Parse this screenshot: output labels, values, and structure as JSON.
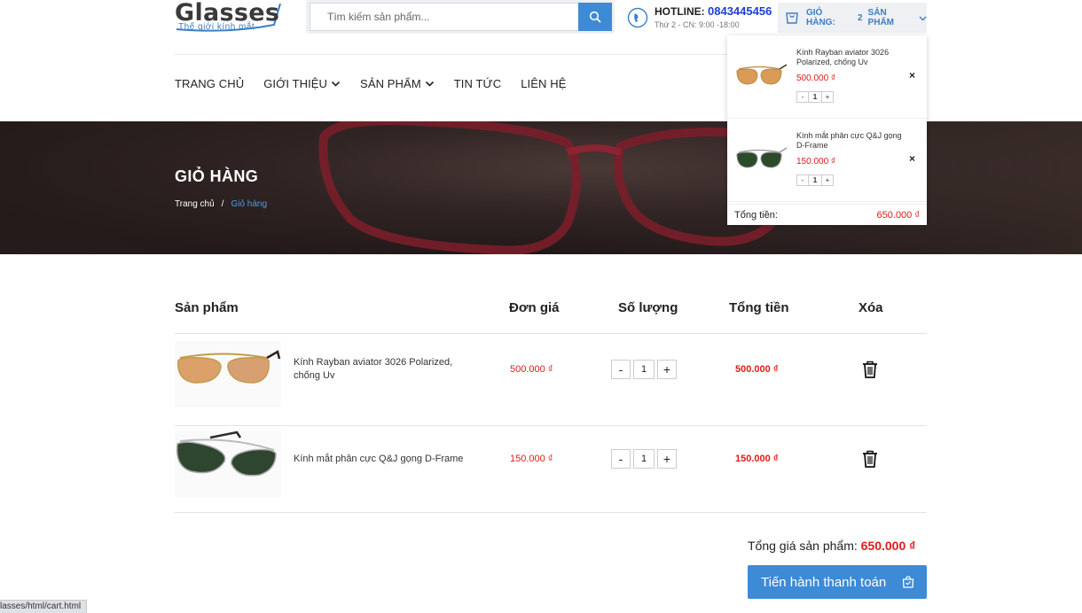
{
  "header": {
    "logo_text": "Glasses",
    "logo_tagline": "Thế giới kính mắt",
    "search_placeholder": "Tìm kiếm sản phẩm...",
    "hotline_label": "HOTLINE:",
    "hotline_number": "0843445456",
    "hotline_hours": "Thứ 2 - CN: 9:00 -18:00",
    "cart_label": "GIỎ HÀNG:",
    "cart_count": "2",
    "cart_unit": "SẢN PHẨM"
  },
  "nav": {
    "items": [
      {
        "label": "TRANG CHỦ",
        "has_dropdown": false
      },
      {
        "label": "GIỚI THIỆU",
        "has_dropdown": true
      },
      {
        "label": "SẢN PHẨM",
        "has_dropdown": true
      },
      {
        "label": "TIN TỨC",
        "has_dropdown": false
      },
      {
        "label": "LIÊN HỆ",
        "has_dropdown": false
      }
    ]
  },
  "banner": {
    "title": "GIỎ HÀNG",
    "breadcrumb": [
      "Trang chủ",
      "Giỏ hàng"
    ],
    "separator": "/"
  },
  "mini_cart": {
    "items": [
      {
        "name": "Kính Rayban aviator 3026 Polarized, chống Uv",
        "price": "500.000 ₫",
        "qty": "1",
        "minus": "-",
        "plus": "+",
        "remove": "×"
      },
      {
        "name": "Kính mắt phân cực Q&J gọng D-Frame",
        "price": "150.000 ₫",
        "qty": "1",
        "minus": "-",
        "plus": "+",
        "remove": "×"
      }
    ],
    "total_label": "Tổng tiền:",
    "total_value": "650.000 ₫"
  },
  "cart_table": {
    "headers": {
      "product": "Sản phẩm",
      "unit_price": "Đơn giá",
      "quantity": "Số lượng",
      "total": "Tổng tiền",
      "remove": "Xóa"
    },
    "rows": [
      {
        "name": "Kính Rayban aviator 3026 Polarized, chống Uv",
        "price": "500.000 ₫",
        "qty": "1",
        "minus": "-",
        "plus": "+",
        "total": "500.000 ₫"
      },
      {
        "name": "Kính mắt phân cực Q&J gọng D-Frame",
        "price": "150.000 ₫",
        "qty": "1",
        "minus": "-",
        "plus": "+",
        "total": "150.000 ₫"
      }
    ],
    "grand_total_label": "Tổng giá sản phẩm:",
    "grand_total_value": "650.000 ₫",
    "checkout_label": "Tiến hành thanh toán"
  },
  "status_bar": {
    "url": "lasses/html/cart.html"
  },
  "colors": {
    "accent": "#3d8ad6",
    "price": "#e01b1b",
    "hotline": "#1b3fd4"
  }
}
